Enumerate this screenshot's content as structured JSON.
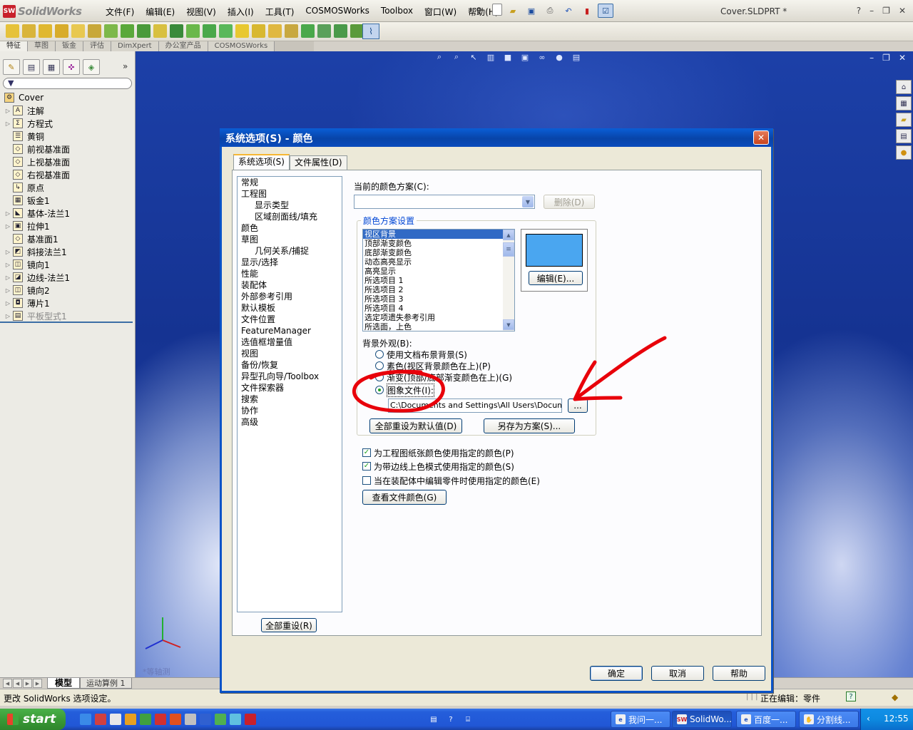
{
  "app": {
    "name": "SolidWorks",
    "badge": "SW",
    "menus": [
      "文件(F)",
      "编辑(E)",
      "视图(V)",
      "插入(I)",
      "工具(T)",
      "COSMOSWorks",
      "Toolbox",
      "窗口(W)",
      "帮助(H)"
    ],
    "doc_title": "Cover.SLDPRT *",
    "help_menu": "?"
  },
  "command_tabs": [
    "特征",
    "草图",
    "钣金",
    "评估",
    "DimXpert",
    "办公室产品",
    "COSMOSWorks"
  ],
  "feature_tree": {
    "root": "Cover",
    "items": [
      {
        "label": "注解",
        "icon": "annotation-icon",
        "glyph": "A",
        "expand": true
      },
      {
        "label": "方程式",
        "icon": "equation-icon",
        "glyph": "Σ",
        "expand": true
      },
      {
        "label": "黄铜",
        "icon": "material-icon",
        "glyph": "☰",
        "expand": false
      },
      {
        "label": "前视基准面",
        "icon": "plane-icon",
        "glyph": "◇",
        "expand": false
      },
      {
        "label": "上视基准面",
        "icon": "plane-icon",
        "glyph": "◇",
        "expand": false
      },
      {
        "label": "右视基准面",
        "icon": "plane-icon",
        "glyph": "◇",
        "expand": false
      },
      {
        "label": "原点",
        "icon": "origin-icon",
        "glyph": "↳",
        "expand": false
      },
      {
        "label": "钣金1",
        "icon": "sheetmetal-icon",
        "glyph": "▦",
        "expand": false
      },
      {
        "label": "基体-法兰1",
        "icon": "base-flange-icon",
        "glyph": "◣",
        "expand": true
      },
      {
        "label": "拉伸1",
        "icon": "extrude-icon",
        "glyph": "▣",
        "expand": true
      },
      {
        "label": "基准面1",
        "icon": "plane-icon",
        "glyph": "◇",
        "expand": false
      },
      {
        "label": "斜接法兰1",
        "icon": "miter-flange-icon",
        "glyph": "◩",
        "expand": true
      },
      {
        "label": "镜向1",
        "icon": "mirror-icon",
        "glyph": "◫",
        "expand": true
      },
      {
        "label": "边线-法兰1",
        "icon": "edge-flange-icon",
        "glyph": "◪",
        "expand": true
      },
      {
        "label": "镜向2",
        "icon": "mirror-icon",
        "glyph": "◫",
        "expand": true
      },
      {
        "label": "薄片1",
        "icon": "tab-icon",
        "glyph": "◘",
        "expand": true
      },
      {
        "label": "平板型式1",
        "icon": "flat-pattern-icon",
        "glyph": "▤",
        "expand": true,
        "grayed": true
      }
    ]
  },
  "bottom_tabs": {
    "model": "模型",
    "motion": "运动算例 1"
  },
  "status": {
    "left": "更改 SolidWorks 选项设定。",
    "right": "正在编辑：零件",
    "help": "?"
  },
  "viewport": {
    "orientation": "*等轴测"
  },
  "dialog": {
    "title": "系统选项(S) - 颜色",
    "close": "✕",
    "tabs": [
      "系统选项(S)",
      "文件属性(D)"
    ],
    "categories": [
      {
        "label": "常规",
        "sub": false
      },
      {
        "label": "工程图",
        "sub": false
      },
      {
        "label": "显示类型",
        "sub": true
      },
      {
        "label": "区域剖面线/填充",
        "sub": true
      },
      {
        "label": "颜色",
        "sub": false
      },
      {
        "label": "草图",
        "sub": false
      },
      {
        "label": "几何关系/捕捉",
        "sub": true
      },
      {
        "label": "显示/选择",
        "sub": false
      },
      {
        "label": "性能",
        "sub": false
      },
      {
        "label": "装配体",
        "sub": false
      },
      {
        "label": "外部参考引用",
        "sub": false
      },
      {
        "label": "默认模板",
        "sub": false
      },
      {
        "label": "文件位置",
        "sub": false
      },
      {
        "label": "FeatureManager",
        "sub": false
      },
      {
        "label": "选值框增量值",
        "sub": false
      },
      {
        "label": "视图",
        "sub": false
      },
      {
        "label": "备份/恢复",
        "sub": false
      },
      {
        "label": "异型孔向导/Toolbox",
        "sub": false
      },
      {
        "label": "文件探索器",
        "sub": false
      },
      {
        "label": "搜索",
        "sub": false
      },
      {
        "label": "协作",
        "sub": false
      },
      {
        "label": "高级",
        "sub": false
      }
    ],
    "reset_all": "全部重设(R)",
    "current_scheme_label": "当前的颜色方案(C):",
    "current_scheme_value": "",
    "delete_btn": "删除(D)",
    "scheme_settings_label": "颜色方案设置",
    "scheme_items": [
      "视区背景",
      "顶部渐变颜色",
      "底部渐变颜色",
      "动态高亮显示",
      "高亮显示",
      "所选项目 1",
      "所选项目 2",
      "所选项目 3",
      "所选项目 4",
      "选定项遗失参考引用",
      "所选面，上色"
    ],
    "selected_item": "视区背景",
    "swatch_color": "#4aa6f0",
    "edit_btn": "编辑(E)...",
    "background_label": "背景外观(B):",
    "bg_options": [
      {
        "label": "使用文档布景背景(S)",
        "checked": false
      },
      {
        "label": "素色(视区背景颜色在上)(P)",
        "checked": false
      },
      {
        "label": "渐变(顶部/底部渐变颜色在上)(G)",
        "checked": false
      },
      {
        "label": "图象文件(I):",
        "checked": true
      }
    ],
    "image_path": "C:\\Documents and Settings\\All Users\\Documents\\",
    "browse_btn": "...",
    "reset_default_btn": "全部重设为默认值(D)",
    "save_scheme_btn": "另存为方案(S)...",
    "checks": [
      {
        "label": "为工程图纸张颜色使用指定的颜色(P)",
        "checked": true
      },
      {
        "label": "为带边线上色模式使用指定的颜色(S)",
        "checked": true
      },
      {
        "label": "当在装配体中编辑零件时使用指定的颜色(E)",
        "checked": false
      }
    ],
    "view_file_colors_btn": "查看文件颜色(G)",
    "ok": "确定",
    "cancel": "取消",
    "help": "帮助"
  },
  "taskbar": {
    "start": "start",
    "buttons": [
      {
        "label": "我问一...",
        "icon": "e"
      },
      {
        "label": "SolidWo...",
        "icon": "SW"
      },
      {
        "label": "百度一...",
        "icon": "e"
      },
      {
        "label": "分割线...",
        "icon": "✋"
      }
    ],
    "clock": "12:55"
  },
  "colors": {
    "dialog_title": "#0a53c8",
    "selection": "#316ac5",
    "annotation": "#e8000a",
    "group_label": "#0046d5"
  }
}
